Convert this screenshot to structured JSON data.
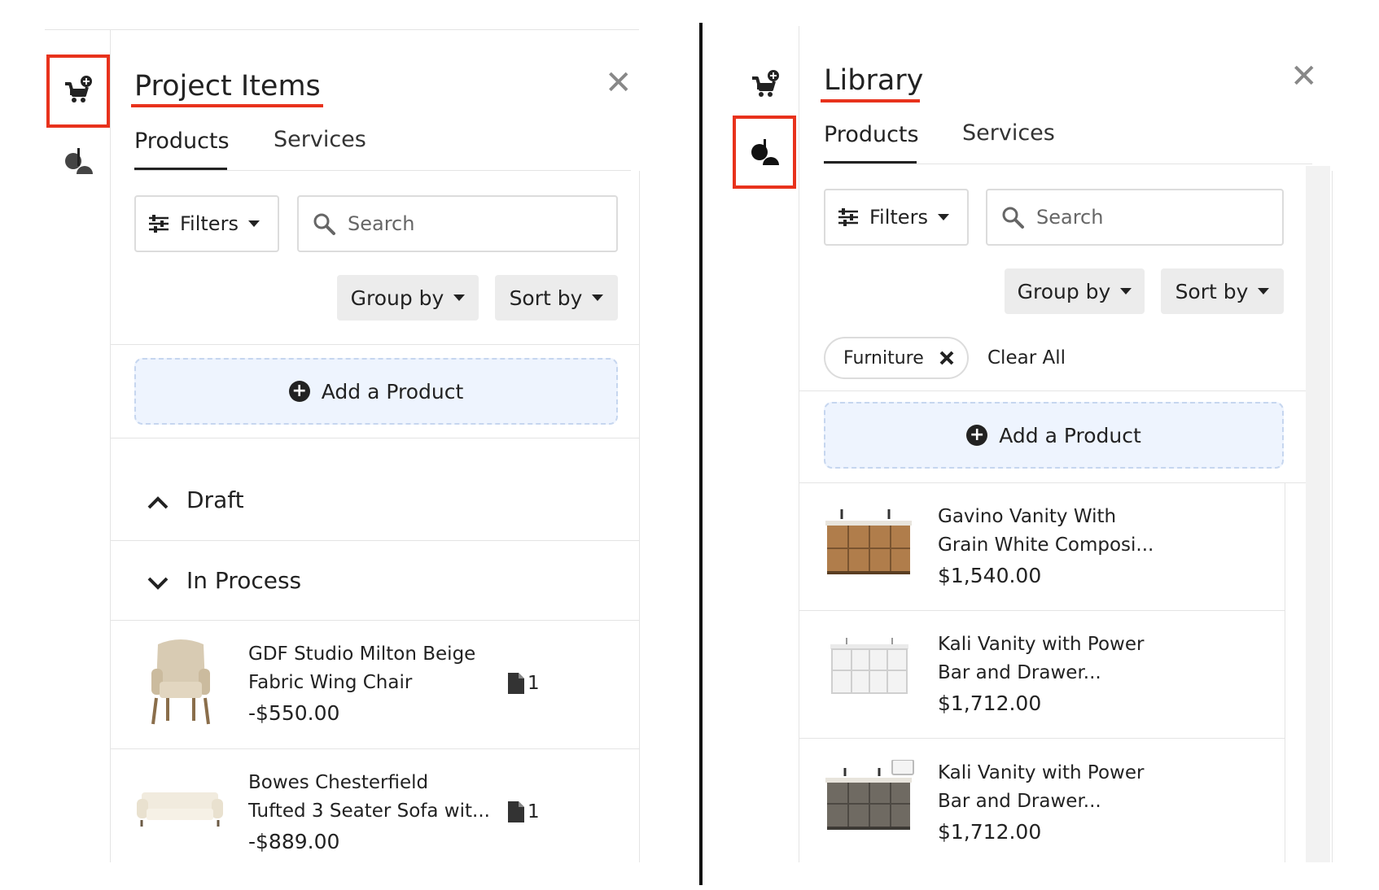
{
  "left_panel": {
    "title": "Project Items",
    "close_symbol": "✕",
    "rail_icons": [
      "cart-add-icon",
      "paint-shapes-icon"
    ],
    "tabs": [
      {
        "label": "Products",
        "active": true
      },
      {
        "label": "Services",
        "active": false
      }
    ],
    "filters_label": "Filters",
    "search_placeholder": "Search",
    "group_by_label": "Group by",
    "sort_by_label": "Sort by",
    "add_product_label": "Add a Product",
    "sections": [
      {
        "label": "Draft",
        "expanded": true
      },
      {
        "label": "In Process",
        "expanded": false
      }
    ],
    "items": [
      {
        "name_line1": "GDF Studio Milton Beige",
        "name_line2": "Fabric Wing Chair",
        "price": "-$550.00",
        "doc_count": "1"
      },
      {
        "name_line1": "Bowes Chesterfield",
        "name_line2": "Tufted 3 Seater Sofa wit...",
        "price": "-$889.00",
        "doc_count": "1"
      }
    ]
  },
  "right_panel": {
    "title": "Library",
    "close_symbol": "✕",
    "rail_icons": [
      "cart-add-icon",
      "paint-shapes-icon"
    ],
    "tabs": [
      {
        "label": "Products",
        "active": true
      },
      {
        "label": "Services",
        "active": false
      }
    ],
    "filters_label": "Filters",
    "search_placeholder": "Search",
    "group_by_label": "Group by",
    "sort_by_label": "Sort by",
    "chip_label": "Furniture",
    "clear_all_label": "Clear All",
    "add_product_label": "Add a Product",
    "items": [
      {
        "name_line1": "Gavino Vanity With",
        "name_line2": "Grain White Composi...",
        "price": "$1,540.00"
      },
      {
        "name_line1": "Kali Vanity with Power",
        "name_line2": "Bar and Drawer...",
        "price": "$1,712.00"
      },
      {
        "name_line1": "Kali Vanity with Power",
        "name_line2": "Bar and Drawer...",
        "price": "$1,712.00"
      }
    ]
  },
  "colors": {
    "highlight": "#e8321c",
    "add_bg": "#eef4fe",
    "button_bg": "#ececec"
  }
}
